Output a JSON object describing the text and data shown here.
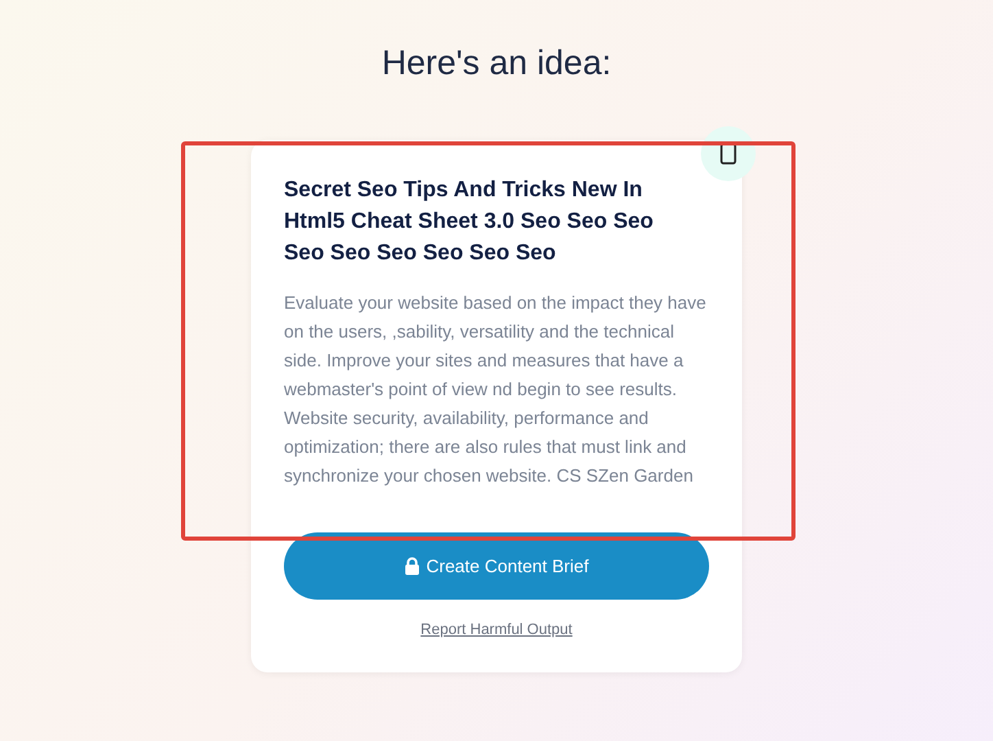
{
  "heading": "Here's an idea:",
  "card": {
    "title": "Secret Seo Tips And Tricks New In Html5 Cheat Sheet 3.0 Seo Seo Seo Seo Seo Seo Seo Seo Seo",
    "body": "Evaluate your website based on the impact they have on the users, ,sability, versatility and the technical side. Improve your sites and measures that have a webmaster's point of view nd begin to see results. Website security, availability, performance and optimization; there are also rules that must link and synchronize your chosen website. CS SZen Garden",
    "highlighted": true
  },
  "button": {
    "label": "Create Content Brief"
  },
  "link": "Report Harmful Output"
}
